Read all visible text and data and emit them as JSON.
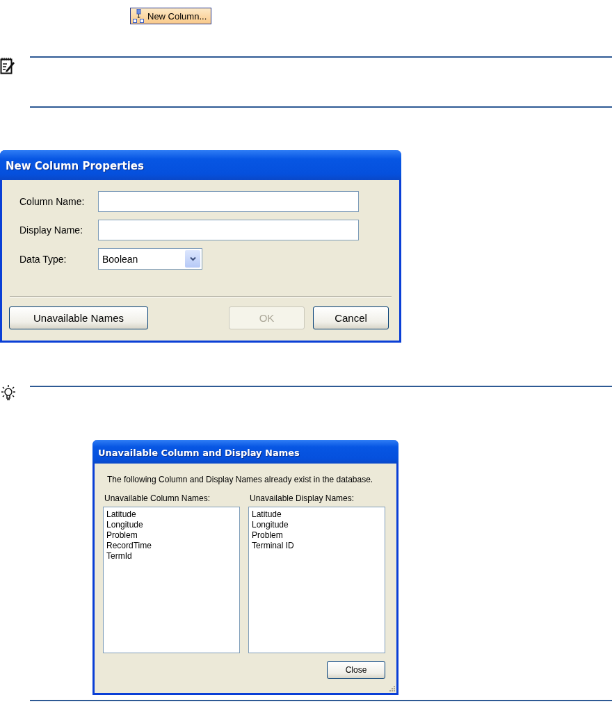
{
  "toolbar_button": {
    "label": "New Column..."
  },
  "new_column_dialog": {
    "title": "New Column Properties",
    "fields": [
      {
        "label": "Column Name:"
      },
      {
        "label": "Display Name:"
      }
    ],
    "data_type": {
      "label": "Data Type:",
      "value": "Boolean"
    },
    "buttons": [
      {
        "label": "Unavailable Names",
        "disabled": false,
        "kind": "auxiliary"
      },
      {
        "label": "OK",
        "disabled": true,
        "kind": "action"
      },
      {
        "label": "Cancel",
        "disabled": false,
        "kind": "action"
      }
    ]
  },
  "unavailable_dialog": {
    "title": "Unavailable Column and Display Names",
    "message": "The following Column and Display Names already exist in the database.",
    "lists": [
      {
        "label": "Unavailable Column Names:",
        "items": [
          "Latitude",
          "Longitude",
          "Problem",
          "RecordTime",
          "TermId"
        ]
      },
      {
        "label": "Unavailable Display Names:",
        "items": [
          "Latitude",
          "Longitude",
          "Problem",
          "Terminal ID"
        ]
      }
    ],
    "buttons": [
      {
        "label": "Close",
        "disabled": false
      }
    ]
  }
}
